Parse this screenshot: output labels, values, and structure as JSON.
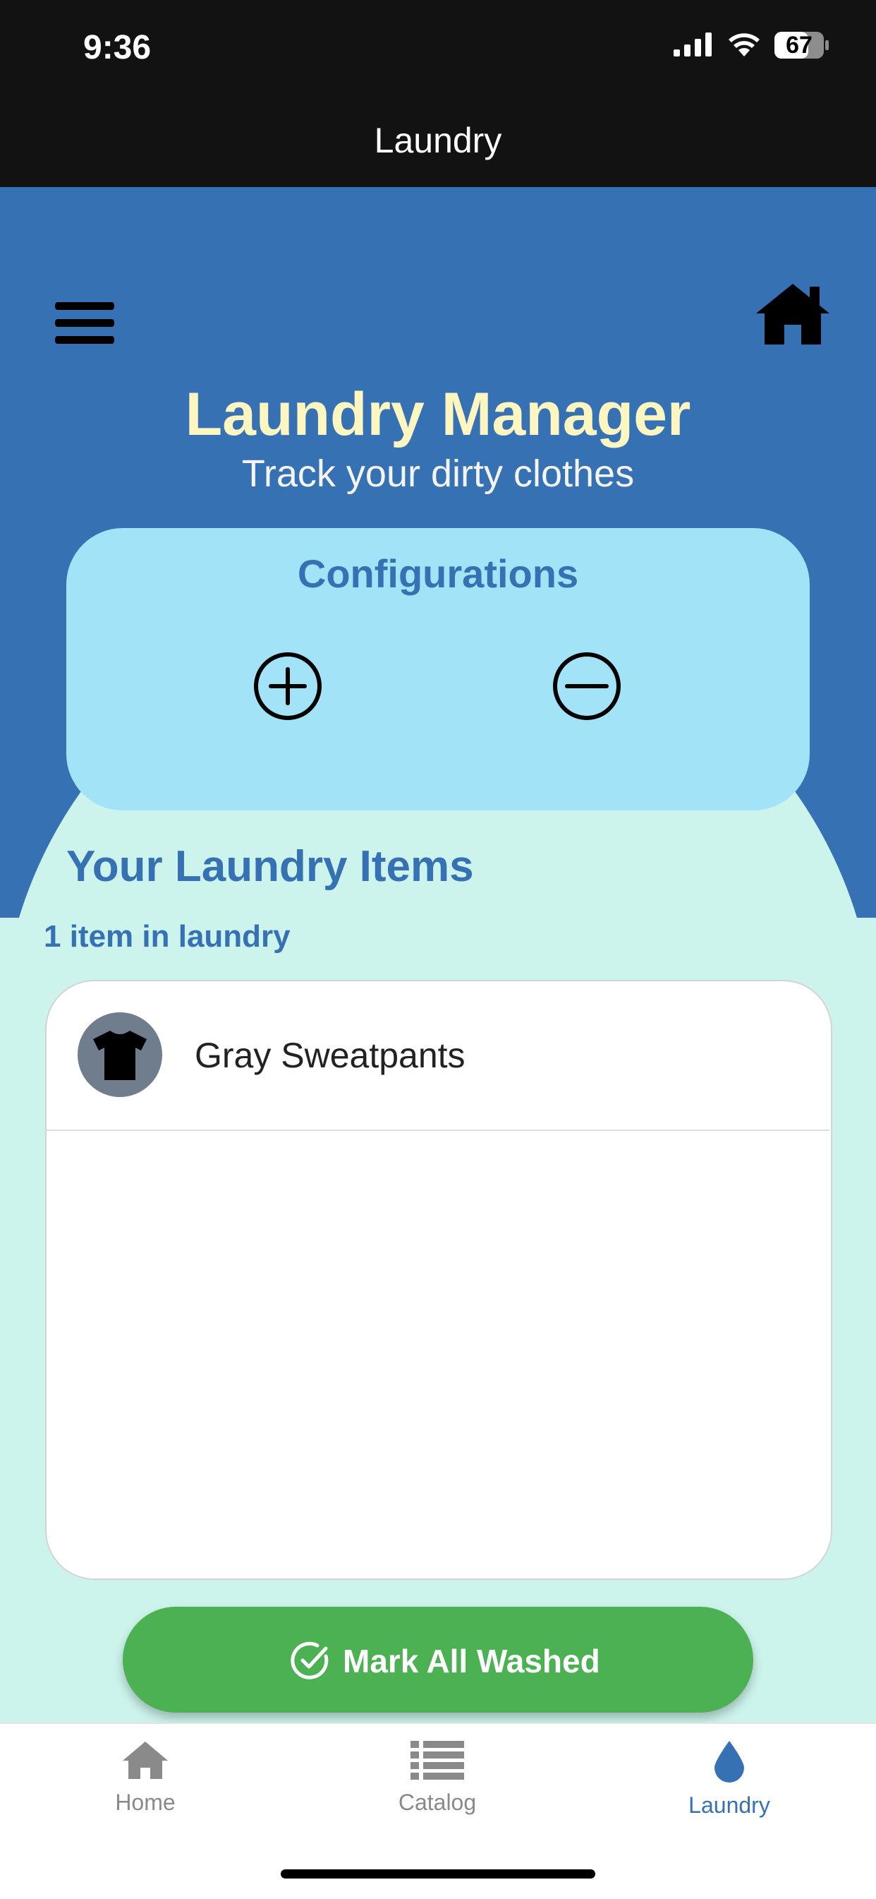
{
  "status_bar": {
    "time": "9:36",
    "battery": "67"
  },
  "nav": {
    "title": "Laundry"
  },
  "hero": {
    "title": "Laundry Manager",
    "subtitle": "Track your dirty clothes"
  },
  "configurations": {
    "title": "Configurations"
  },
  "items_section": {
    "heading": "Your Laundry Items",
    "count_text": "1 item in laundry",
    "items": [
      {
        "name": "Gray Sweatpants",
        "icon": "shirt-icon"
      }
    ]
  },
  "actions": {
    "mark_all_washed": "Mark All Washed"
  },
  "tabs": [
    {
      "label": "Home",
      "icon": "home-icon",
      "active": false
    },
    {
      "label": "Catalog",
      "icon": "list-icon",
      "active": false
    },
    {
      "label": "Laundry",
      "icon": "water-drop-icon",
      "active": true
    }
  ],
  "colors": {
    "primary_blue": "#3672b3",
    "mint_background": "#cdf4ec",
    "config_card": "#a2e3f7",
    "title_cream": "#fdf6c0",
    "success_green": "#4cb152",
    "header_dark": "#121212"
  }
}
